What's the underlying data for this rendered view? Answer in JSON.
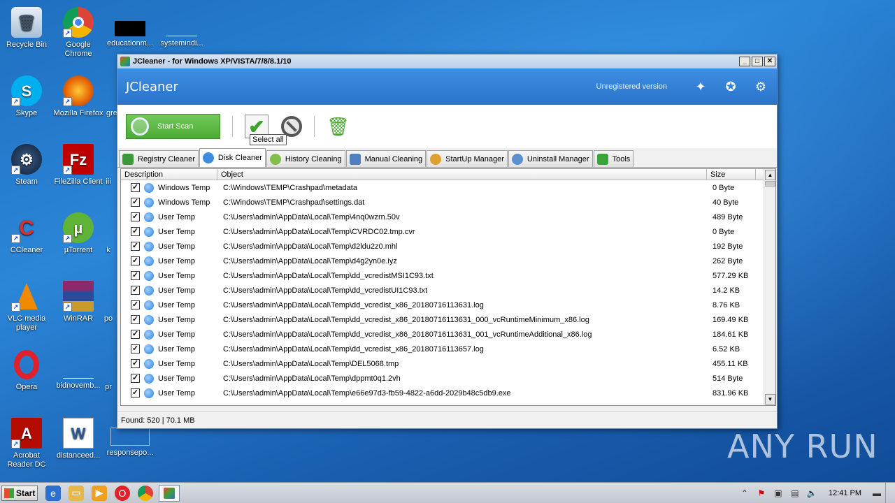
{
  "desktop": {
    "icons": [
      {
        "label": "Recycle Bin"
      },
      {
        "label": "Google Chrome"
      },
      {
        "label": "educationm..."
      },
      {
        "label": "systemindi..."
      },
      {
        "label": "Skype"
      },
      {
        "label": "Mozilla Firefox"
      },
      {
        "label": "gre"
      },
      {
        "label": "Steam"
      },
      {
        "label": "FileZilla Client"
      },
      {
        "label": "iii"
      },
      {
        "label": "CCleaner"
      },
      {
        "label": "µTorrent"
      },
      {
        "label": "k"
      },
      {
        "label": "VLC media player"
      },
      {
        "label": "WinRAR"
      },
      {
        "label": "po"
      },
      {
        "label": "Opera"
      },
      {
        "label": "bidnovemb..."
      },
      {
        "label": "pr"
      },
      {
        "label": "Acrobat Reader DC"
      },
      {
        "label": "distanceed..."
      },
      {
        "label": "responsepo..."
      }
    ]
  },
  "window": {
    "title": "JCleaner - for Windows XP/VISTA/7/8/8.1/10",
    "app_name": "JCleaner",
    "registration": "Unregistered version",
    "toolbar": {
      "scan_label": "Start Scan",
      "tooltip": "Select all"
    },
    "tabs": [
      {
        "label": "Registry Cleaner",
        "color": "#3a9a3a"
      },
      {
        "label": "Disk Cleaner",
        "color": "#3b8ee0",
        "active": true
      },
      {
        "label": "History Cleaning",
        "color": "#7fbf4a"
      },
      {
        "label": "Manual Cleaning",
        "color": "#4f7fbf"
      },
      {
        "label": "StartUp Manager",
        "color": "#e0a030"
      },
      {
        "label": "Uninstall Manager",
        "color": "#5a8fd0"
      },
      {
        "label": "Tools",
        "color": "#3aa33a"
      }
    ],
    "columns": {
      "description": "Description",
      "object": "Object",
      "size": "Size"
    },
    "rows": [
      {
        "desc": "Windows Temp",
        "path": "C:\\Windows\\TEMP\\Crashpad\\metadata",
        "size": "0 Byte"
      },
      {
        "desc": "Windows Temp",
        "path": "C:\\Windows\\TEMP\\Crashpad\\settings.dat",
        "size": "40 Byte"
      },
      {
        "desc": "User Temp",
        "path": "C:\\Users\\admin\\AppData\\Local\\Temp\\4nq0wzrn.50v",
        "size": "489 Byte"
      },
      {
        "desc": "User Temp",
        "path": "C:\\Users\\admin\\AppData\\Local\\Temp\\CVRDC02.tmp.cvr",
        "size": "0 Byte"
      },
      {
        "desc": "User Temp",
        "path": "C:\\Users\\admin\\AppData\\Local\\Temp\\d2ldu2z0.mhl",
        "size": "192 Byte"
      },
      {
        "desc": "User Temp",
        "path": "C:\\Users\\admin\\AppData\\Local\\Temp\\d4g2yn0e.iyz",
        "size": "262 Byte"
      },
      {
        "desc": "User Temp",
        "path": "C:\\Users\\admin\\AppData\\Local\\Temp\\dd_vcredistMSI1C93.txt",
        "size": "577.29 KB"
      },
      {
        "desc": "User Temp",
        "path": "C:\\Users\\admin\\AppData\\Local\\Temp\\dd_vcredistUI1C93.txt",
        "size": "14.2 KB"
      },
      {
        "desc": "User Temp",
        "path": "C:\\Users\\admin\\AppData\\Local\\Temp\\dd_vcredist_x86_20180716113631.log",
        "size": "8.76 KB"
      },
      {
        "desc": "User Temp",
        "path": "C:\\Users\\admin\\AppData\\Local\\Temp\\dd_vcredist_x86_20180716113631_000_vcRuntimeMinimum_x86.log",
        "size": "169.49 KB"
      },
      {
        "desc": "User Temp",
        "path": "C:\\Users\\admin\\AppData\\Local\\Temp\\dd_vcredist_x86_20180716113631_001_vcRuntimeAdditional_x86.log",
        "size": "184.61 KB"
      },
      {
        "desc": "User Temp",
        "path": "C:\\Users\\admin\\AppData\\Local\\Temp\\dd_vcredist_x86_20180716113657.log",
        "size": "6.52 KB"
      },
      {
        "desc": "User Temp",
        "path": "C:\\Users\\admin\\AppData\\Local\\Temp\\DEL5068.tmp",
        "size": "455.11 KB"
      },
      {
        "desc": "User Temp",
        "path": "C:\\Users\\admin\\AppData\\Local\\Temp\\dppmt0q1.2vh",
        "size": "514 Byte"
      },
      {
        "desc": "User Temp",
        "path": "C:\\Users\\admin\\AppData\\Local\\Temp\\e66e97d3-fb59-4822-a6dd-2029b48c5db9.exe",
        "size": "831.96 KB"
      }
    ],
    "status": "Found: 520 | 70.1 MB"
  },
  "taskbar": {
    "start": "Start",
    "clock": "12:41 PM"
  },
  "watermark": "ANY RUN"
}
